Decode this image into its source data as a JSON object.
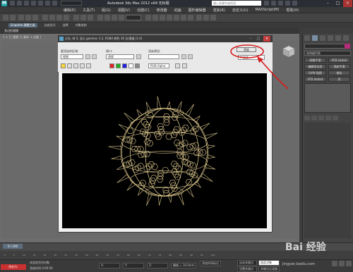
{
  "app": {
    "title": "Autodesk 3ds Max 2012 x64",
    "title_suffix": "无标题",
    "search_placeholder": "键入关键字或短语",
    "logo_letter": "M"
  },
  "menu": [
    "编辑(E)",
    "工具(T)",
    "组(G)",
    "视图(V)",
    "创建(C)",
    "修改器",
    "动画",
    "图形编辑器",
    "渲染(R)",
    "自定义(U)",
    "MAXScript(M)",
    "帮助(H)"
  ],
  "toolbar": {
    "selection_filter": "全部"
  },
  "ribbon": {
    "tabs": [
      "Graphite 建模工具",
      "自由形式",
      "选择",
      "对象绘制"
    ],
    "sub_label": "多边形建模",
    "viewport_label": "[ + ] [ 透视 ] [ 真实 + 边面 ]"
  },
  "render_window": {
    "title": "正在, 帧 0, 显示 gamma: 2.2, RGBA 颜色 16 位/通道 (1:4)",
    "area_label": "要渲染的区域:",
    "area_value": "视图",
    "viewport_label": "视口:",
    "viewport_value": "透视",
    "preset_label": "渲染预设:",
    "preset_value": "",
    "render_button": "渲染",
    "production_value": "产品级",
    "channel_value": "RGB Alpha"
  },
  "command_panel": {
    "modifier_list": "修改器列表",
    "buttons": [
      "网格平滑",
      "FFD 2x2x2",
      "编辑多边形",
      "涡轮平滑",
      "UVW 贴图",
      "锥化",
      "FFD 4x4x4",
      "壳",
      "晶格",
      "编辑网格"
    ],
    "swatch_color": "#b42d7a"
  },
  "timeline": {
    "slider": "0 / 100",
    "ticks": [
      "0",
      "5",
      "10",
      "15",
      "20",
      "25",
      "30",
      "35",
      "40",
      "45",
      "50",
      "55",
      "60",
      "65",
      "70",
      "75",
      "80",
      "85",
      "90",
      "95",
      "100"
    ]
  },
  "status": {
    "red_label": "所在行:",
    "line1": "未选定任何对象",
    "line2": "渲染时间 0:00:00",
    "x_field": "X:",
    "y_field": "Y:",
    "z_field": "Z:",
    "grid": "栅格 = 10.0mm",
    "auto_key": "自动关键点",
    "selected": "选定对象",
    "set_key": "设置关键点",
    "filters": "关键点过滤器...",
    "add_time_tag": "添加时间标记"
  },
  "watermark": {
    "text": "Bai 经验",
    "sub": "jingyan.baidu.com"
  },
  "colors": {
    "accent_red": "#c93030",
    "annotation_red": "#d81e1e",
    "wire": "#d9c48a"
  }
}
